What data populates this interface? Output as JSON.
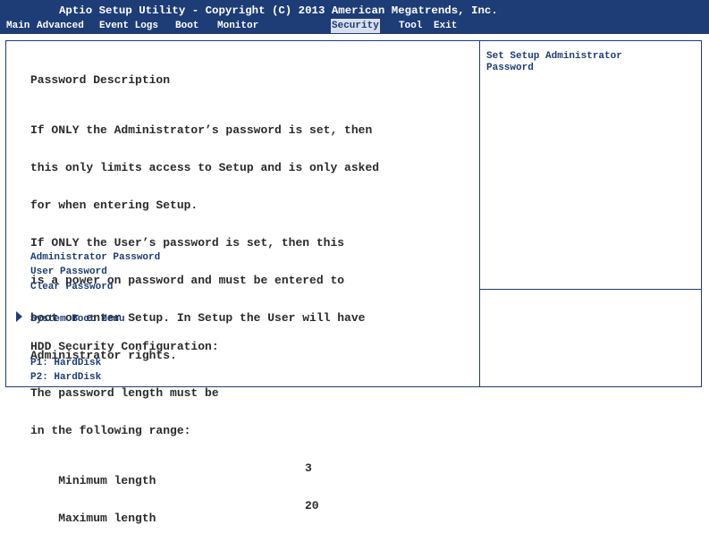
{
  "header": {
    "title": "Aptio Setup Utility - Copyright (C) 2013 American Megatrends, Inc.",
    "menu": [
      {
        "label": "Main",
        "active": false
      },
      {
        "label": "Advanced",
        "active": false
      },
      {
        "label": "Event Logs",
        "active": false
      },
      {
        "label": "Boot",
        "active": false
      },
      {
        "label": "Monitor",
        "active": false
      },
      {
        "label": "Security",
        "active": true
      },
      {
        "label": "Tool",
        "active": false
      },
      {
        "label": "Exit",
        "active": false
      }
    ]
  },
  "description": {
    "title": "Password Description",
    "lines": [
      "If ONLY the Administrator’s password is set, then",
      "this only limits access to Setup and is only asked",
      "for when entering Setup.",
      "If ONLY the User’s password is set, then this",
      "is a power on password and must be entered to",
      "boot or enter Setup. In Setup the User will have",
      "Administrator rights.",
      "The password length must be",
      "in the following range:"
    ],
    "min_label": "Minimum length",
    "min_value": "3",
    "max_label": "Maximum length",
    "max_value": "20"
  },
  "items": {
    "admin_password": "Administrator Password",
    "user_password": "User Password",
    "clear_password": "Clear Password",
    "system_boot_menu": "System Boot Menu",
    "hdd_label": "HDD Security Configuration:",
    "p1": "P1: HardDisk",
    "p2": "P2: HardDisk"
  },
  "help": {
    "text": "Set Setup Administrator\nPassword"
  },
  "colors": {
    "header_bg": "#1e3c76",
    "active_tab_bg": "#d7dfee",
    "link": "#1e3c76",
    "text": "#2a2a2a",
    "border": "#1e3c76"
  },
  "icons": {
    "submenu": "triangle-right-icon"
  }
}
